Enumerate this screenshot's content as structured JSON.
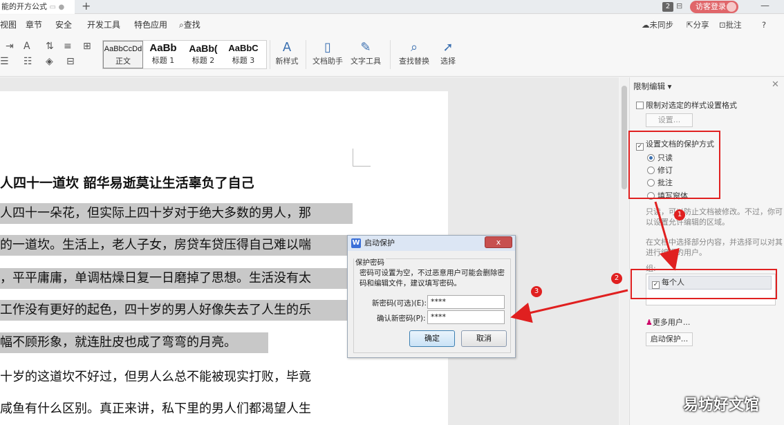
{
  "titlebar": {
    "doc_tab": "能的开方公式",
    "plus": "+",
    "badge": "2",
    "login": "访客登录",
    "minimize": "—"
  },
  "menu": {
    "items": [
      "视图",
      "章节",
      "安全",
      "开发工具",
      "特色应用",
      "查找"
    ],
    "right": [
      "未同步",
      "分享",
      "批注",
      "?"
    ]
  },
  "ribbon": {
    "styles": [
      {
        "sample": "AaBbCcDd",
        "label": "正文"
      },
      {
        "sample": "AaBb",
        "label": "标题 1"
      },
      {
        "sample": "AaBb(",
        "label": "标题 2"
      },
      {
        "sample": "AaBbC",
        "label": "标题 3"
      }
    ],
    "buttons": [
      "新样式",
      "文档助手",
      "文字工具",
      "查找替换",
      "选择"
    ]
  },
  "document": {
    "heading": "人四十一道坎 韶华易逝莫让生活辜负了自己",
    "lines": [
      "人四十一朵花，但实际上四十岁对于绝大多数的男人，那",
      "的一道坎。生活上，老人子女，房贷车贷压得自己难以喘",
      "，平平庸庸，单调枯燥日复一日磨掉了思想。生活没有太",
      "工作没有更好的起色，四十岁的男人好像失去了人生的乐",
      "幅不顾形象，就连肚皮也成了弯弯的月亮。",
      "十岁的这道坎不好过，但男人么总不能被现实打败，毕竟",
      "咸鱼有什么区别。真正来讲，私下里的男人们都渴望人生"
    ]
  },
  "panel": {
    "title": "限制编辑",
    "restrict_format": "限制对选定的样式设置格式",
    "settings_button": "设置...",
    "protect_method": "设置文档的保护方式",
    "options": [
      "只读",
      "修订",
      "批注",
      "填写窗体"
    ],
    "desc1": [
      "只读，可以防止文档被修改。不过，你可",
      "以设置允许编辑的区域。"
    ],
    "desc2": [
      "在文档中选择部分内容，并选择可以对其",
      "进行编辑的用户。"
    ],
    "group_label": "组:",
    "group_item": "每个人",
    "more_users": "更多用户...",
    "start_protect": "启动保护..."
  },
  "dialog": {
    "title": "启动保护",
    "close": "x",
    "section": "保护密码",
    "desc": "密码可设置为空，不过恶意用户可能会删除密码和编辑文件，建议填写密码。",
    "new_password_label": "新密码(可选)(E):",
    "new_password_value": "****",
    "confirm_password_label": "确认新密码(P):",
    "confirm_password_value": "****",
    "ok": "确定",
    "cancel": "取消"
  },
  "annotations": {
    "markers": [
      "1",
      "2",
      "3"
    ],
    "color": "#e02020"
  },
  "watermark": "易坊好文馆"
}
